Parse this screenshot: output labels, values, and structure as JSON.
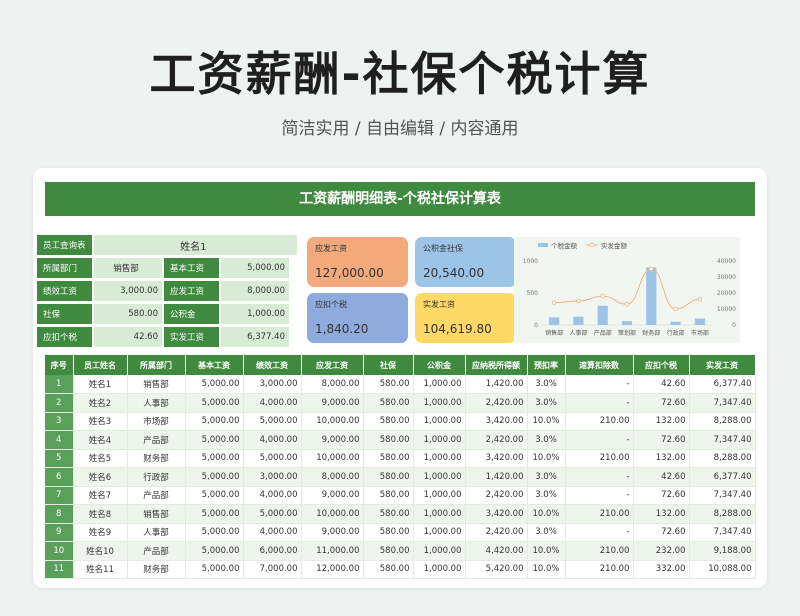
{
  "hero": {
    "title": "工资薪酬-社保个税计算",
    "subtitle": "简洁实用 / 自由编辑 / 内容通用"
  },
  "sheet": {
    "title": "工资薪酬明细表-个税社保计算表"
  },
  "info": {
    "query_label": "员工查询表",
    "name": "姓名1",
    "rows": [
      {
        "l1": "所属部门",
        "v1": "销售部",
        "l2": "基本工资",
        "v2": "5,000.00"
      },
      {
        "l1": "绩效工资",
        "v1": "3,000.00",
        "l2": "应发工资",
        "v2": "8,000.00"
      },
      {
        "l1": "社保",
        "v1": "580.00",
        "l2": "公积金",
        "v2": "1,000.00"
      },
      {
        "l1": "应扣个税",
        "v1": "42.60",
        "l2": "实发工资",
        "v2": "6,377.40"
      }
    ]
  },
  "stats": [
    {
      "label": "应发工资",
      "value": "127,000.00",
      "color": "#f2a97c"
    },
    {
      "label": "公积金社保",
      "value": "20,540.00",
      "color": "#9dc3e6"
    },
    {
      "label": "应扣个税",
      "value": "1,840.20",
      "color": "#8faadc"
    },
    {
      "label": "实发工资",
      "value": "104,619.80",
      "color": "#ffd966"
    }
  ],
  "chart_data": {
    "type": "bar",
    "categories": [
      "销售部",
      "人事部",
      "产品部",
      "策划部",
      "财务部",
      "行政部",
      "市场部"
    ],
    "series": [
      {
        "name": "个税金额",
        "type": "bar",
        "axis": "left",
        "values": [
          120,
          130,
          300,
          60,
          900,
          50,
          100
        ]
      },
      {
        "name": "实发金额",
        "type": "line",
        "axis": "right",
        "values": [
          14000,
          15000,
          18000,
          13000,
          35000,
          10000,
          16000
        ]
      }
    ],
    "ylim_left": [
      0,
      1000
    ],
    "yticks_left": [
      "1000",
      "500",
      "0"
    ],
    "ylim_right": [
      0,
      40000
    ],
    "yticks_right": [
      "40000",
      "30000",
      "20000",
      "10000",
      "0"
    ],
    "legend": "top",
    "colors": {
      "bar": "#9dc3e6",
      "line": "#f4b183"
    }
  },
  "table": {
    "headers": [
      "序号",
      "员工姓名",
      "所属部门",
      "基本工资",
      "绩效工资",
      "应发工资",
      "社保",
      "公积金",
      "应纳税所得额",
      "预扣率",
      "速算扣除数",
      "应扣个税",
      "实发工资"
    ],
    "rows": [
      [
        "1",
        "姓名1",
        "销售部",
        "5,000.00",
        "3,000.00",
        "8,000.00",
        "580.00",
        "1,000.00",
        "1,420.00",
        "3.0%",
        "-",
        "42.60",
        "6,377.40"
      ],
      [
        "2",
        "姓名2",
        "人事部",
        "5,000.00",
        "4,000.00",
        "9,000.00",
        "580.00",
        "1,000.00",
        "2,420.00",
        "3.0%",
        "-",
        "72.60",
        "7,347.40"
      ],
      [
        "3",
        "姓名3",
        "市场部",
        "5,000.00",
        "5,000.00",
        "10,000.00",
        "580.00",
        "1,000.00",
        "3,420.00",
        "10.0%",
        "210.00",
        "132.00",
        "8,288.00"
      ],
      [
        "4",
        "姓名4",
        "产品部",
        "5,000.00",
        "4,000.00",
        "9,000.00",
        "580.00",
        "1,000.00",
        "2,420.00",
        "3.0%",
        "-",
        "72.60",
        "7,347.40"
      ],
      [
        "5",
        "姓名5",
        "财务部",
        "5,000.00",
        "5,000.00",
        "10,000.00",
        "580.00",
        "1,000.00",
        "3,420.00",
        "10.0%",
        "210.00",
        "132.00",
        "8,288.00"
      ],
      [
        "6",
        "姓名6",
        "行政部",
        "5,000.00",
        "3,000.00",
        "8,000.00",
        "580.00",
        "1,000.00",
        "1,420.00",
        "3.0%",
        "-",
        "42.60",
        "6,377.40"
      ],
      [
        "7",
        "姓名7",
        "产品部",
        "5,000.00",
        "4,000.00",
        "9,000.00",
        "580.00",
        "1,000.00",
        "2,420.00",
        "3.0%",
        "-",
        "72.60",
        "7,347.40"
      ],
      [
        "8",
        "姓名8",
        "销售部",
        "5,000.00",
        "5,000.00",
        "10,000.00",
        "580.00",
        "1,000.00",
        "3,420.00",
        "10.0%",
        "210.00",
        "132.00",
        "8,288.00"
      ],
      [
        "9",
        "姓名9",
        "人事部",
        "5,000.00",
        "4,000.00",
        "9,000.00",
        "580.00",
        "1,000.00",
        "2,420.00",
        "3.0%",
        "-",
        "72.60",
        "7,347.40"
      ],
      [
        "10",
        "姓名10",
        "产品部",
        "5,000.00",
        "6,000.00",
        "11,000.00",
        "580.00",
        "1,000.00",
        "4,420.00",
        "10.0%",
        "210.00",
        "232.00",
        "9,188.00"
      ],
      [
        "11",
        "姓名11",
        "财务部",
        "5,000.00",
        "7,000.00",
        "12,000.00",
        "580.00",
        "1,000.00",
        "5,420.00",
        "10.0%",
        "210.00",
        "332.00",
        "10,088.00"
      ]
    ]
  }
}
